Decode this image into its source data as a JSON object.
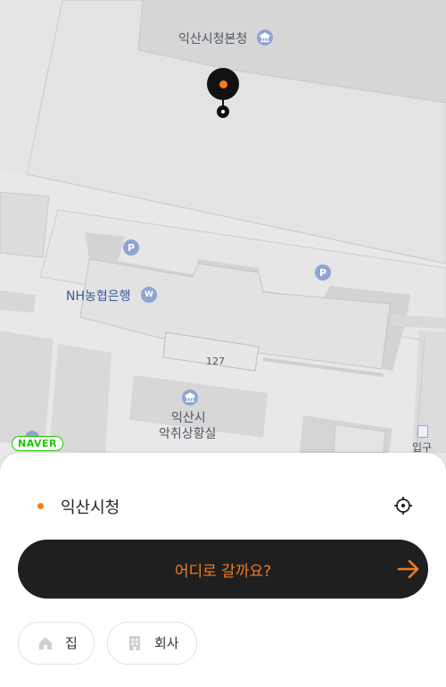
{
  "map": {
    "labels": {
      "city_hall": "익산시청본청",
      "nh_bank": "NH농협은행",
      "road_number": "127",
      "office_line1": "익산시",
      "office_line2": "악취상황실",
      "entrance": "입구"
    },
    "badges": {
      "parking": "P",
      "bank": "W"
    },
    "provider": "NAVER",
    "pin_color": "#111111",
    "accent": "#f47b20"
  },
  "sheet": {
    "origin": "익산시청",
    "search_placeholder": "어디로 갈까요?",
    "quick_places": [
      {
        "label": "집",
        "icon": "home-icon"
      },
      {
        "label": "회사",
        "icon": "building-icon"
      }
    ]
  }
}
